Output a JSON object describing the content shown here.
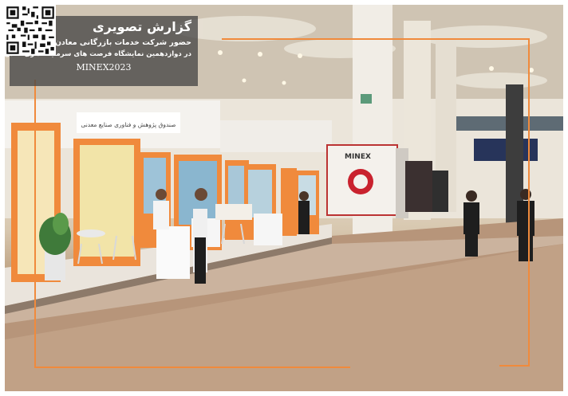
{
  "report": {
    "title": "گزارش تصویری",
    "line1": "حضور شرکت خدمات بازرگانی معادن و فلزات غیرآهنی",
    "line2": "در دوازدهمین نمایشگاه فرصت های سرمایه گذاری معدن و صنایع معدنی",
    "event_tag": "MINEX2023"
  },
  "scene": {
    "booth_sign": "صندوق پژوهش و فناوری صنایع معدنی",
    "pillar_sign": "MINEX",
    "frame_color": "#f08a3c",
    "logo_color": "#f08a3c"
  }
}
